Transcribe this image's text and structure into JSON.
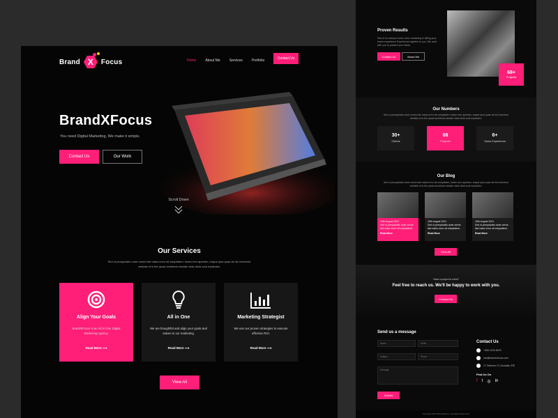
{
  "brand": {
    "left": "Brand",
    "x": "X",
    "right": "Focus"
  },
  "nav": {
    "items": [
      "Home",
      "About Me",
      "Services",
      "Portfolio"
    ],
    "contact": "Contact Us"
  },
  "hero": {
    "title": "BrandXFocus",
    "subtitle": "You need Digital Marketing, We make it simple.",
    "btn_primary": "Contact Us",
    "btn_secondary": "Our Work",
    "scroll": "Scroll Down"
  },
  "services": {
    "title": "Our Services",
    "desc_line1": "Sed ut perspiciatis unde omnis iste natus error sit voluptatem. totam rem aperiam, eaque ipsa quae ab illo inventore",
    "desc_line2": "veritatis et is the quasi architecto beatae vitae dicta sunt explicabo.",
    "cards": [
      {
        "title": "Align Your Goals",
        "desc": "BrandXFocus is an All in One Digital Marketing Agency.",
        "link": "Read More",
        "icon": "target-icon"
      },
      {
        "title": "All in One",
        "desc": "We are thoughtful and align your goals and values to our marketing.",
        "link": "Read More",
        "icon": "lightbulb-icon"
      },
      {
        "title": "Marketing Strategist",
        "desc": "We use our proven strategies to execute effective ROI.",
        "link": "Read More",
        "icon": "chart-icon"
      }
    ],
    "view_all": "View All"
  },
  "proven": {
    "title": "Proven Results",
    "desc": "Sed ut is a tempor lorem dolor marketing is sitting your brand experience Experience together to you. We work with you to present your ideas.",
    "btn_primary": "Contact Us",
    "btn_secondary": "About Me",
    "badge_num": "68+",
    "badge_label": "Projects"
  },
  "numbers": {
    "title": "Our Numbers",
    "desc_line1": "Sed ut perspiciatis unde omnis iste natus error sit voluptatem. totam rem aperiam, eaque ipsa quae ab illo inventore",
    "desc_line2": "veritatis et is the quasi architecto beatae vitae dicta sunt explicabo.",
    "items": [
      {
        "num": "30+",
        "label": "Clients"
      },
      {
        "num": "68",
        "label": "Projects"
      },
      {
        "num": "6+",
        "label": "Years Experience"
      }
    ]
  },
  "blog": {
    "title": "Our Blog",
    "desc_line1": "Sed ut perspiciatis unde omnis iste natus error sit voluptatem. totam rem aperiam, eaque ipsa quae ab illo inventore",
    "desc_line2": "veritatis et is the quasi architecto beatae vitae dicta sunt explicabo.",
    "posts": [
      {
        "date": "15th August 2021",
        "text": "Sed ut perspiciatis unde omnis iste natus error sit voluptatem.",
        "link": "Read More"
      },
      {
        "date": "15th August 2021",
        "text": "Sed ut perspiciatis unde omnis iste natus error sit voluptatem.",
        "link": "Read More"
      },
      {
        "date": "15th August 2021",
        "text": "Sed ut perspiciatis unde omnis iste natus error sit voluptatem.",
        "link": "Read More"
      }
    ],
    "view_all": "View All"
  },
  "cta": {
    "small": "Have a project in mind?",
    "title": "Feel free to reach us. We'll be happy to work with you.",
    "btn": "Contact Us"
  },
  "form": {
    "title": "Send us a message",
    "name": "Name",
    "email": "Email",
    "subject": "Subject",
    "phone": "Phone",
    "message": "Message",
    "submit": "Submit"
  },
  "contact": {
    "title": "Contact Us",
    "phone": "+353 1234 5678",
    "email": "info@brandxfocus.com",
    "address": "17 Gleneen Ct, Dundalk, IRE",
    "find": "Find Us On"
  },
  "footer": "Copyright 2021 BrandXFocus. All Rights Reserved.",
  "colors": {
    "accent": "#ff1e78",
    "bg": "#050505",
    "page_bg": "#2b2b2b"
  }
}
